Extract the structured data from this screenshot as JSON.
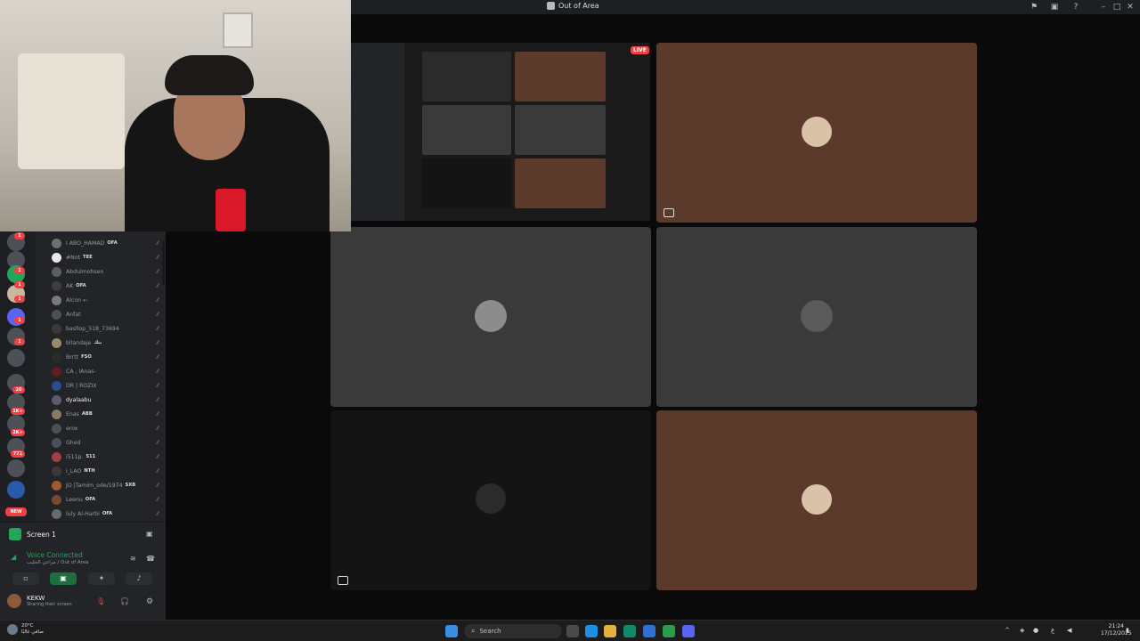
{
  "window": {
    "title": "Out of Area"
  },
  "live_badge": "LIVE",
  "members": [
    {
      "name": "I ABO_HAMAD",
      "tag": "OFA"
    },
    {
      "name": "#Not",
      "tag": "TEE"
    },
    {
      "name": "Abdulmohsen",
      "tag": ""
    },
    {
      "name": "AK",
      "tag": "OFA"
    },
    {
      "name": "Alcon ←",
      "tag": ""
    },
    {
      "name": "Anfat",
      "tag": ""
    },
    {
      "name": "basllop_518_73694",
      "tag": ""
    },
    {
      "name": "bllandaje",
      "tag": "بنك"
    },
    {
      "name": "Brrtt",
      "tag": "FSO"
    },
    {
      "name": "CA , lAnas-",
      "tag": ""
    },
    {
      "name": "DR | ROZIX",
      "tag": ""
    },
    {
      "name": "dyalaabu",
      "tag": ""
    },
    {
      "name": "Enas",
      "tag": "ABB"
    },
    {
      "name": "erox",
      "tag": ""
    },
    {
      "name": "Ghed",
      "tag": ""
    },
    {
      "name": "i511p.",
      "tag": "511"
    },
    {
      "name": "i_LAO",
      "tag": "NTH"
    },
    {
      "name": "JO |Tamim_ode/1974",
      "tag": "SXB"
    },
    {
      "name": "Leenu",
      "tag": "OFA"
    },
    {
      "name": "luly Al-Harbi",
      "tag": "OFA"
    }
  ],
  "guild_badges": [
    "1",
    "1",
    "1",
    "1",
    "1",
    "1",
    "20",
    "1K+",
    "2K+",
    "771",
    "NEW"
  ],
  "panel": {
    "screen_label": "Screen 1",
    "voice_status": "Voice Connected",
    "voice_channel": "مراعي الحليب / Out of Area",
    "user_name": "KEKW",
    "user_status": "Sharing their screen"
  },
  "taskbar": {
    "search_placeholder": "Search",
    "weather_temp": "20°C",
    "weather_desc": "صافي غالبًا",
    "time": "21:24",
    "date": "17/12/2025"
  },
  "colors": {
    "tile_brown": "#5b3a2c",
    "tile_gray": "#3a3a3b",
    "voice_green": "#23a55a",
    "live_red": "#ed4245"
  },
  "icons": [
    "search-icon",
    "settings-icon",
    "mute-icon",
    "screen-share-icon",
    "windows-start-icon",
    "hangup-icon"
  ]
}
